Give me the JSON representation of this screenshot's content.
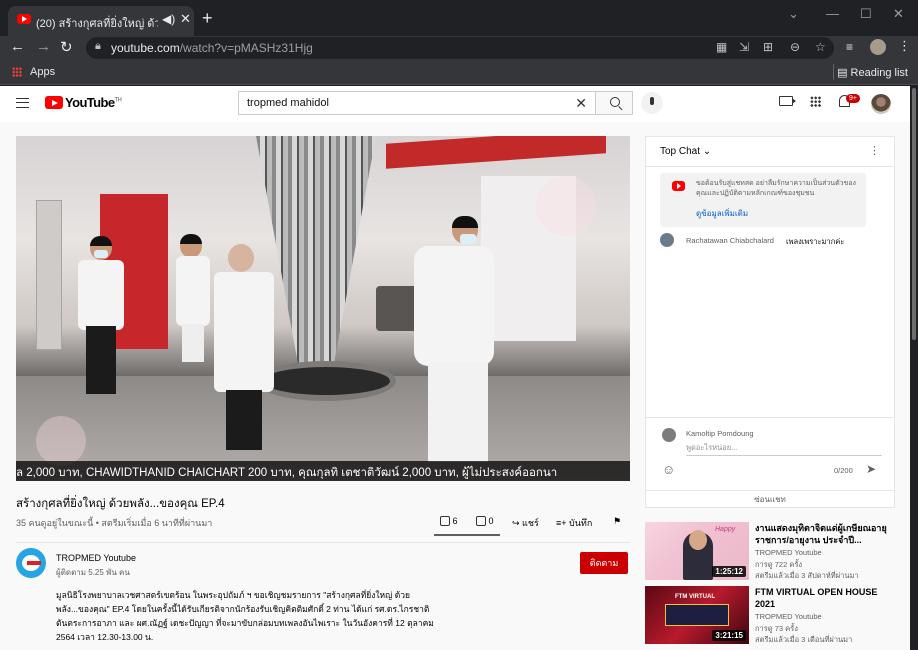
{
  "browser": {
    "tab_title": "(20) สร้างกุศลที่ยิ่งใหญ่ ด้วยพลัง...",
    "url_host": "youtube.com",
    "url_path": "/watch?v=pMASHz31Hjg",
    "apps_label": "Apps",
    "reading_list_label": "Reading list"
  },
  "youtube": {
    "logo_text": "YouTube",
    "logo_region": "TH",
    "search_query": "tropmed mahidol",
    "notification_badge": "9+"
  },
  "video": {
    "subtitle_text": "ล 2,000 บาท, CHAWIDTHANID CHAICHART 200 บาท, คุณกุลทิ เตชาติวัฒน์ 2,000 บาท, ผู้ไม่ประสงค์ออกนา",
    "title": "สร้างกุศลที่ยิ่งใหญ่ ด้วยพลัง...ของคุณ EP.4",
    "meta": "35 คนดูอยู่ในขณะนี้ • สตรีมเริ่มเมื่อ 6 นาทีที่ผ่านมา",
    "likes": "6",
    "dislikes": "0",
    "share_label": "แชร์",
    "save_label": "บันทึก",
    "like_ratio": 1.0
  },
  "channel": {
    "name": "TROPMED Youtube",
    "subscribers": "ผู้ติดตาม 5.25 พัน คน",
    "subscribe_label": "ติดตาม",
    "description": "มูลนิธิโรงพยาบาลเวชศาสตร์เขตร้อน ในพระอุปถัมภ์ ฯ ขอเชิญชมรายการ \"สร้างกุศลที่ยิ่งใหญ่ ด้วยพลัง...ของคุณ\" EP.4 โดยในครั้งนี้ได้รับเกียรติจากนักร้องรับเชิญคิตติมศักดิ์ 2 ท่าน ได้แก่ รศ.ดร.ไกรชาติ ตันตระการอาภา และ ผศ.ณัฏฐ์ เดชะปัญญา ที่จะมาขับกล่อมบทเพลงอันไพเราะ ในวันอังคารที่ 12 ตุลาคม 2564 เวลา 12.30-13.00 น."
  },
  "chat": {
    "header": "Top Chat",
    "notice": "ขอต้อนรับสู่แชทสด อย่าลืมรักษาความเป็นส่วนตัวของคุณและปฏิบัติตามหลักเกณฑ์ของชุมชน",
    "notice_link": "ดูข้อมูลเพิ่มเติม",
    "messages": [
      {
        "author": "Rachatawan Chiabchalard",
        "text": "เพลงเพราะมากค่ะ"
      }
    ],
    "current_user": "Kamoltip Pomdoung",
    "input_placeholder": "พูดอะไรหน่อย...",
    "char_count": "0/200",
    "hide_label": "ซ่อนแชท"
  },
  "related": [
    {
      "title": "งานแสดงมุทิตาจิตแด่ผู้เกษียณอายุราชการ/อายุงาน ประจำปี...",
      "channel": "TROPMED Youtube",
      "views": "การดู 722 ครั้ง",
      "when": "สตรีมแล้วเมื่อ 3 สัปดาห์ที่ผ่านมา",
      "duration": "1:25:12"
    },
    {
      "title": "FTM VIRTUAL OPEN HOUSE 2021",
      "channel": "TROPMED Youtube",
      "views": "การดู 73 ครั้ง",
      "when": "สตรีมแล้วเมื่อ 3 เดือนที่ผ่านมา",
      "duration": "3:21:15"
    }
  ],
  "colors": {
    "youtube_red": "#ff0000",
    "subscribe_red": "#cc0000",
    "link_blue": "#065fd4",
    "chrome_dark": "#202124"
  },
  "icons": [
    "menu-icon",
    "youtube-logo-icon",
    "search-icon",
    "mic-icon",
    "create-video-icon",
    "apps-grid-icon",
    "bell-icon",
    "like-icon",
    "dislike-icon",
    "share-icon",
    "save-icon",
    "flag-icon",
    "emoji-icon",
    "send-icon"
  ]
}
